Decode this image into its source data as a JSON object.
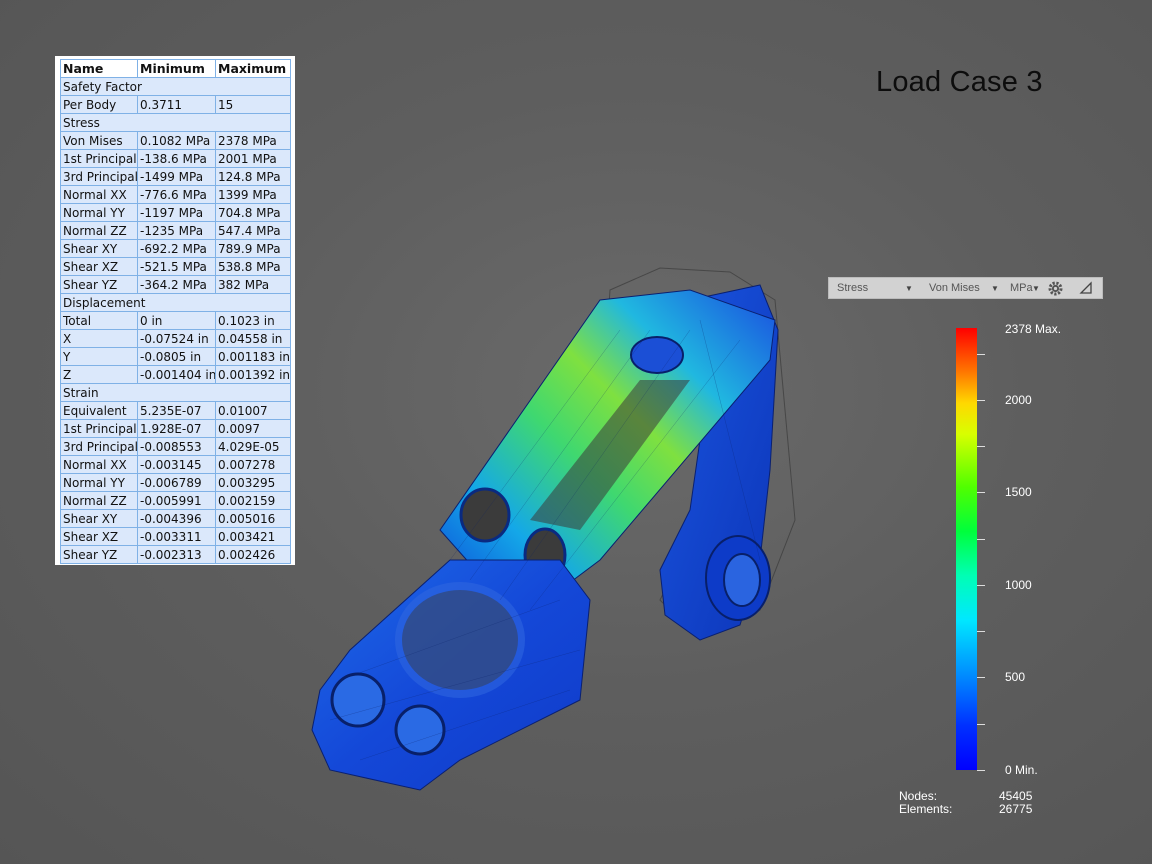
{
  "title": "Load Case 3",
  "results_table": {
    "headers": [
      "Name",
      "Minimum",
      "Maximum"
    ],
    "rows": [
      {
        "section": "Safety Factor"
      },
      {
        "name": "Per Body",
        "min": "0.3711",
        "max": "15"
      },
      {
        "section": "Stress"
      },
      {
        "name": "Von Mises",
        "min": "0.1082 MPa",
        "max": "2378 MPa"
      },
      {
        "name": "1st Principal",
        "min": "-138.6 MPa",
        "max": "2001 MPa"
      },
      {
        "name": "3rd Principal",
        "min": "-1499 MPa",
        "max": "124.8 MPa"
      },
      {
        "name": "Normal XX",
        "min": "-776.6 MPa",
        "max": "1399 MPa"
      },
      {
        "name": "Normal YY",
        "min": "-1197 MPa",
        "max": "704.8 MPa"
      },
      {
        "name": "Normal ZZ",
        "min": "-1235 MPa",
        "max": "547.4 MPa"
      },
      {
        "name": "Shear XY",
        "min": "-692.2 MPa",
        "max": "789.9 MPa"
      },
      {
        "name": "Shear XZ",
        "min": "-521.5 MPa",
        "max": "538.8 MPa"
      },
      {
        "name": "Shear YZ",
        "min": "-364.2 MPa",
        "max": "382 MPa"
      },
      {
        "section": "Displacement"
      },
      {
        "name": "Total",
        "min": "0 in",
        "max": "0.1023 in"
      },
      {
        "name": "X",
        "min": "-0.07524 in",
        "max": "0.04558 in"
      },
      {
        "name": "Y",
        "min": "-0.0805 in",
        "max": "0.001183 in"
      },
      {
        "name": "Z",
        "min": "-0.001404 in",
        "max": "0.001392 in"
      },
      {
        "section": "Strain"
      },
      {
        "name": "Equivalent",
        "min": "5.235E-07",
        "max": "0.01007"
      },
      {
        "name": "1st Principal",
        "min": "1.928E-07",
        "max": "0.0097"
      },
      {
        "name": "3rd Principal",
        "min": "-0.008553",
        "max": "4.029E-05"
      },
      {
        "name": "Normal XX",
        "min": "-0.003145",
        "max": "0.007278"
      },
      {
        "name": "Normal YY",
        "min": "-0.006789",
        "max": "0.003295"
      },
      {
        "name": "Normal ZZ",
        "min": "-0.005991",
        "max": "0.002159"
      },
      {
        "name": "Shear XY",
        "min": "-0.004396",
        "max": "0.005016"
      },
      {
        "name": "Shear XZ",
        "min": "-0.003311",
        "max": "0.003421"
      },
      {
        "name": "Shear YZ",
        "min": "-0.002313",
        "max": "0.002426"
      }
    ]
  },
  "legend": {
    "result_type": "Stress",
    "component": "Von Mises",
    "unit": "MPa",
    "icons": [
      "gear-icon",
      "corner-resize-icon"
    ],
    "max_label": "2378 Max.",
    "min_label": "0 Min.",
    "scale_min": 0,
    "scale_max": 2378,
    "tick_labels": [
      {
        "value": 2000,
        "text": "2000"
      },
      {
        "value": 1500,
        "text": "1500"
      },
      {
        "value": 1000,
        "text": "1000"
      },
      {
        "value": 500,
        "text": "500"
      }
    ],
    "colors": [
      "#ff0000",
      "#ffd800",
      "#00ff00",
      "#00e8ff",
      "#0000ff"
    ]
  },
  "mesh_stats": {
    "nodes_label": "Nodes:",
    "nodes_value": "45405",
    "elements_label": "Elements:",
    "elements_value": "26775"
  },
  "viewport": {
    "background_color": "#5e5e5e",
    "model_base_color": "#1a48d8"
  }
}
